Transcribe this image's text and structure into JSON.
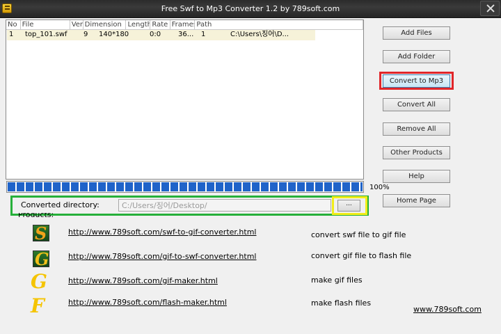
{
  "window": {
    "title": "Free Swf to Mp3 Converter 1.2 by 789soft.com"
  },
  "file_list": {
    "columns": [
      "No",
      "File",
      "Ver",
      "Dimension",
      "Length",
      "Rate",
      "Frames",
      "Path"
    ],
    "rows": [
      {
        "no": "1",
        "file": "top_101.swf",
        "ver": "9",
        "dimension": "140*180",
        "length": "0:0",
        "rate": "36...",
        "frames": "1",
        "path": "C:\\Users\\징어\\D..."
      }
    ]
  },
  "progress": {
    "percent_text": "100%",
    "value": 100
  },
  "directory": {
    "label": "Converted directory:",
    "value": "C:/Users/징어/Desktop/",
    "browse_label": "..."
  },
  "buttons": {
    "add_files": "Add Files",
    "add_folder": "Add Folder",
    "convert": "Convert to Mp3",
    "convert_all": "Convert All",
    "remove_all": "Remove All",
    "other_products": "Other Products",
    "help": "Help",
    "home_page": "Home Page"
  },
  "products": {
    "label": "Products:",
    "items": [
      {
        "icon": "S",
        "url": "http://www.789soft.com/swf-to-gif-converter.html",
        "desc": "convert swf file to gif file"
      },
      {
        "icon": "G",
        "url": "http://www.789soft.com/gif-to-swf-converter.html",
        "desc": "convert gif file to flash file"
      },
      {
        "icon": "G",
        "url": "http://www.789soft.com/gif-maker.html",
        "desc": "make gif files"
      },
      {
        "icon": "F",
        "url": "http://www.789soft.com/flash-maker.html",
        "desc": "make flash files"
      }
    ]
  },
  "site": {
    "url": "www.789soft.com"
  },
  "colors": {
    "progress_fill": "#1f63c9",
    "highlight_green": "#26b03a",
    "highlight_yellow": "#f2ed1a",
    "highlight_red": "#e0262a",
    "icon_letter_yellow": "#f5c400"
  }
}
